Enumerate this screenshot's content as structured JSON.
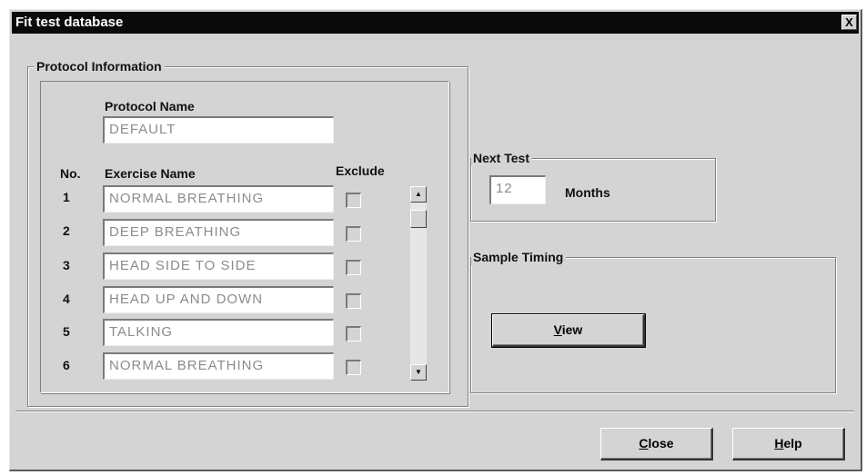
{
  "window": {
    "title": "Fit test database",
    "close_glyph": "X"
  },
  "protocol": {
    "group_label": "Protocol Information",
    "name_label": "Protocol Name",
    "name_value": "DEFAULT",
    "col_no": "No.",
    "col_exercise": "Exercise Name",
    "col_exclude": "Exclude",
    "exercises": [
      {
        "no": "1",
        "name": "NORMAL BREATHING",
        "excluded": false
      },
      {
        "no": "2",
        "name": "DEEP BREATHING",
        "excluded": false
      },
      {
        "no": "3",
        "name": "HEAD SIDE TO SIDE",
        "excluded": false
      },
      {
        "no": "4",
        "name": "HEAD UP AND DOWN",
        "excluded": false
      },
      {
        "no": "5",
        "name": "TALKING",
        "excluded": false
      },
      {
        "no": "6",
        "name": "NORMAL BREATHING",
        "excluded": false
      }
    ],
    "scroll_up_glyph": "▲",
    "scroll_down_glyph": "▼"
  },
  "next_test": {
    "group_label": "Next Test",
    "value": "12",
    "unit": "Months"
  },
  "sample_timing": {
    "group_label": "Sample Timing",
    "view_button": {
      "accel": "V",
      "rest": "iew"
    }
  },
  "footer": {
    "close_button": {
      "accel": "C",
      "rest": "lose"
    },
    "help_button": {
      "accel": "H",
      "rest": "elp"
    }
  },
  "colors": {
    "titlebar": "#0a0a0a",
    "dialog_face": "#d4d4d4",
    "field_text": "#8c8c8c"
  }
}
